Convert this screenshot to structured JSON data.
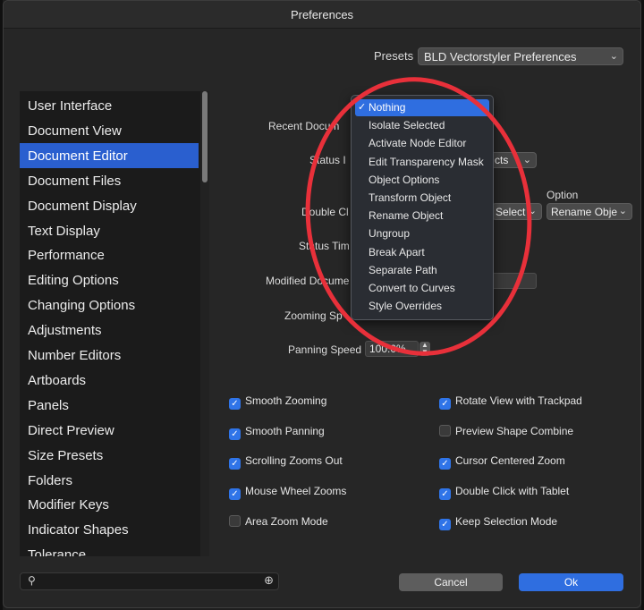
{
  "window": {
    "title": "Preferences"
  },
  "presets": {
    "label": "Presets",
    "value": "BLD Vectorstyler Preferences"
  },
  "sidebar": {
    "items": [
      {
        "label": "User Interface"
      },
      {
        "label": "Document View"
      },
      {
        "label": "Document Editor"
      },
      {
        "label": "Document Files"
      },
      {
        "label": "Document Display"
      },
      {
        "label": "Text Display"
      },
      {
        "label": "Performance"
      },
      {
        "label": "Editing Options"
      },
      {
        "label": "Changing Options"
      },
      {
        "label": "Adjustments"
      },
      {
        "label": "Number Editors"
      },
      {
        "label": "Artboards"
      },
      {
        "label": "Panels"
      },
      {
        "label": "Direct Preview"
      },
      {
        "label": "Size Presets"
      },
      {
        "label": "Folders"
      },
      {
        "label": "Modifier Keys"
      },
      {
        "label": "Indicator Shapes"
      },
      {
        "label": "Tolerance"
      }
    ],
    "selected": "Document Editor"
  },
  "form": {
    "recent_documents_label": "Recent Docum",
    "status_label": "Status I",
    "status_select_value": "cts",
    "option_header": "Option",
    "double_click_label": "Double Cl",
    "double_click_value": "Select",
    "double_click_option_value": "Rename Obje",
    "status_time_label": "Status Tim",
    "modified_documents_label": "Modified Docume",
    "zooming_speed_label": "Zooming Sp",
    "panning_speed_label": "Panning Speed",
    "panning_speed_value": "100.0%"
  },
  "checkboxes": {
    "left": [
      {
        "label": "Smooth Zooming",
        "checked": true
      },
      {
        "label": "Smooth Panning",
        "checked": true
      },
      {
        "label": "Scrolling Zooms Out",
        "checked": true
      },
      {
        "label": "Mouse Wheel Zooms",
        "checked": true
      },
      {
        "label": "Area Zoom Mode",
        "checked": false
      }
    ],
    "right": [
      {
        "label": "Rotate View with Trackpad",
        "checked": true
      },
      {
        "label": "Preview Shape Combine",
        "checked": false
      },
      {
        "label": "Cursor Centered Zoom",
        "checked": true
      },
      {
        "label": "Double Click with Tablet",
        "checked": true
      },
      {
        "label": "Keep Selection Mode",
        "checked": true
      }
    ]
  },
  "dropdown": {
    "selected": "Nothing",
    "items": [
      "Nothing",
      "Isolate Selected",
      "Activate Node Editor",
      "Edit Transparency Mask",
      "Object Options",
      "Transform Object",
      "Rename Object",
      "Ungroup",
      "Break Apart",
      "Separate Path",
      "Convert to Curves",
      "Style Overrides"
    ]
  },
  "buttons": {
    "cancel": "Cancel",
    "ok": "Ok"
  },
  "colors": {
    "accent": "#2f6ee0",
    "annotation_ring": "#e8303a"
  },
  "icons": [
    "check-icon",
    "chevron-down-icon",
    "search-icon",
    "zoom-in-icon"
  ]
}
